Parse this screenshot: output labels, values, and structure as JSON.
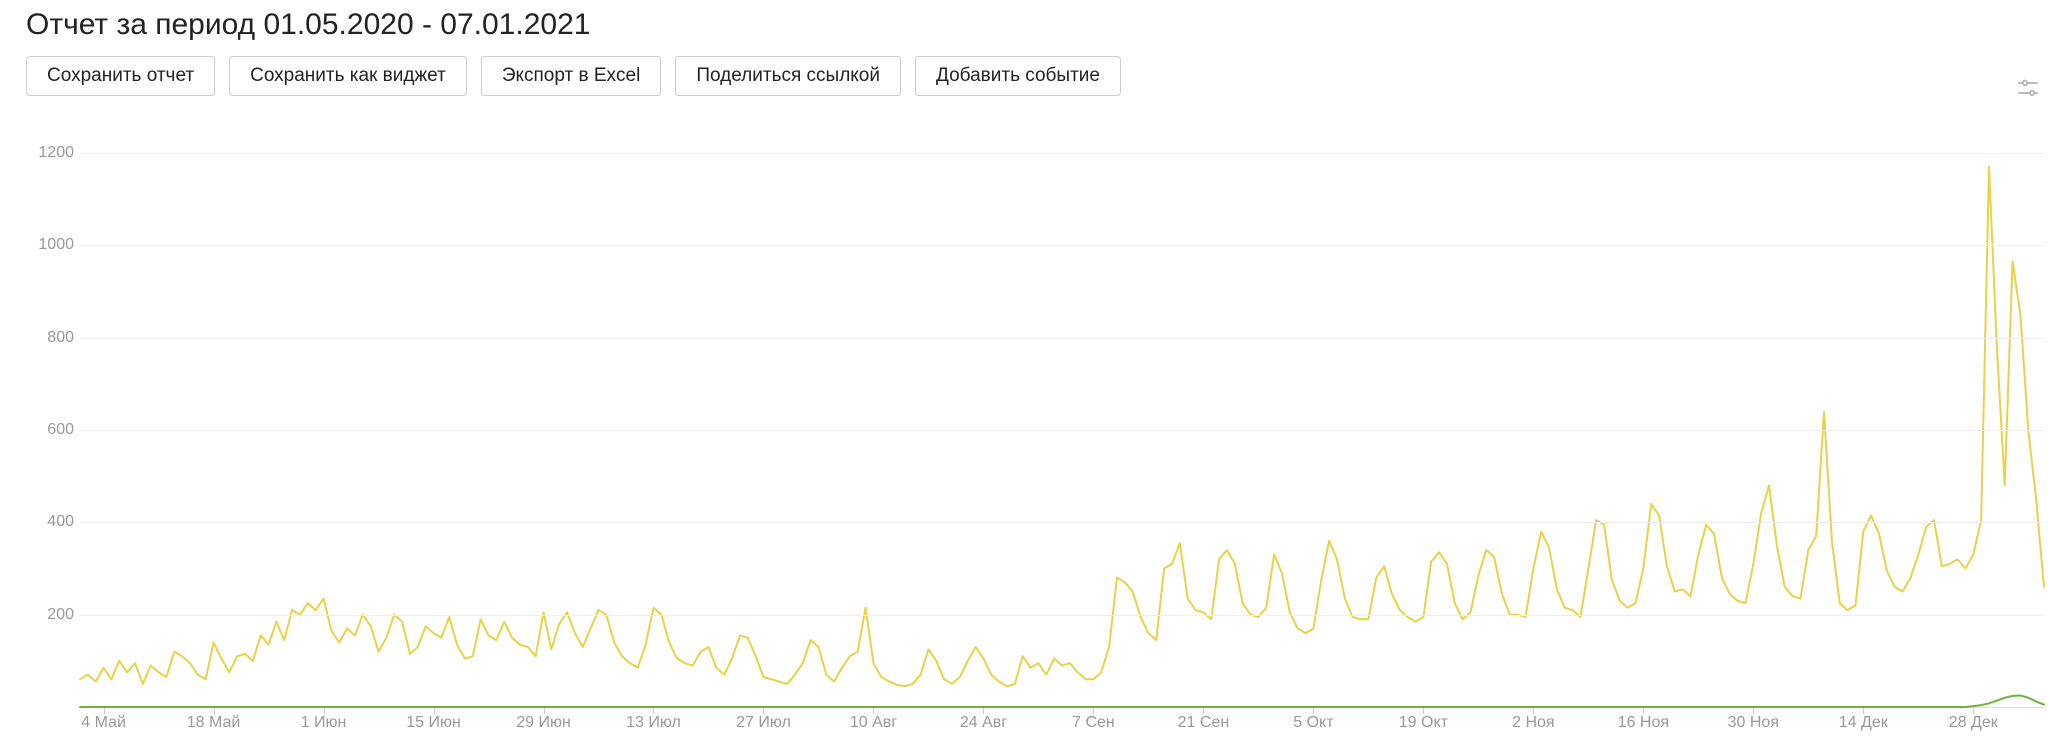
{
  "header": {
    "title": "Отчет за период 01.05.2020 - 07.01.2021"
  },
  "toolbar": {
    "save_report": "Сохранить отчет",
    "save_widget": "Сохранить как виджет",
    "export_excel": "Экспорт в Excel",
    "share_link": "Поделиться ссылкой",
    "add_event": "Добавить событие"
  },
  "chart_data": {
    "type": "line",
    "ylim": [
      0,
      1250
    ],
    "y_ticks": [
      200,
      400,
      600,
      800,
      1000,
      1200
    ],
    "x_tick_labels": [
      "4 Май",
      "18 Май",
      "1 Июн",
      "15 Июн",
      "29 Июн",
      "13 Июл",
      "27 Июл",
      "10 Авг",
      "24 Авг",
      "7 Сен",
      "21 Сен",
      "5 Окт",
      "19 Окт",
      "2 Ноя",
      "16 Ноя",
      "30 Ноя",
      "14 Дек",
      "28 Дек"
    ],
    "x_tick_indices": [
      3,
      17,
      31,
      45,
      59,
      73,
      87,
      101,
      115,
      129,
      143,
      157,
      171,
      185,
      199,
      213,
      227,
      241
    ],
    "colors": {
      "yellow": "#e8d24a",
      "green": "#6fb23c"
    },
    "series": [
      {
        "name": "yellow",
        "values": [
          60,
          70,
          55,
          85,
          60,
          100,
          75,
          95,
          50,
          90,
          75,
          65,
          120,
          110,
          95,
          70,
          60,
          140,
          105,
          75,
          110,
          115,
          100,
          155,
          135,
          185,
          145,
          210,
          200,
          225,
          210,
          235,
          165,
          140,
          170,
          155,
          200,
          175,
          120,
          150,
          200,
          185,
          115,
          130,
          175,
          160,
          150,
          195,
          135,
          105,
          110,
          190,
          155,
          145,
          185,
          150,
          135,
          130,
          110,
          205,
          125,
          180,
          205,
          160,
          130,
          170,
          210,
          200,
          140,
          110,
          95,
          85,
          135,
          215,
          200,
          140,
          105,
          95,
          90,
          120,
          130,
          85,
          70,
          105,
          155,
          150,
          110,
          65,
          60,
          55,
          50,
          70,
          95,
          145,
          130,
          70,
          55,
          85,
          110,
          120,
          215,
          95,
          65,
          55,
          48,
          45,
          50,
          70,
          125,
          100,
          60,
          50,
          65,
          100,
          130,
          105,
          70,
          55,
          45,
          50,
          110,
          85,
          95,
          70,
          105,
          90,
          95,
          75,
          60,
          60,
          75,
          130,
          280,
          270,
          250,
          195,
          160,
          145,
          300,
          310,
          355,
          235,
          210,
          205,
          190,
          320,
          340,
          310,
          225,
          200,
          195,
          215,
          330,
          290,
          205,
          170,
          160,
          170,
          275,
          360,
          320,
          235,
          195,
          190,
          190,
          280,
          305,
          245,
          210,
          195,
          185,
          195,
          315,
          335,
          310,
          225,
          190,
          205,
          285,
          340,
          325,
          245,
          200,
          200,
          195,
          300,
          380,
          345,
          255,
          215,
          210,
          195,
          300,
          405,
          395,
          275,
          230,
          215,
          225,
          300,
          440,
          415,
          305,
          250,
          255,
          240,
          330,
          395,
          375,
          280,
          245,
          230,
          225,
          310,
          420,
          480,
          350,
          260,
          240,
          235,
          340,
          370,
          640,
          360,
          225,
          210,
          220,
          380,
          415,
          375,
          295,
          260,
          250,
          280,
          330,
          390,
          405,
          305,
          310,
          320,
          300,
          330,
          405,
          1170,
          780,
          480,
          965,
          850,
          600,
          450,
          260
        ]
      },
      {
        "name": "green",
        "values": [
          0,
          0,
          0,
          0,
          0,
          0,
          0,
          0,
          0,
          0,
          0,
          0,
          0,
          0,
          0,
          0,
          0,
          0,
          0,
          0,
          0,
          0,
          0,
          0,
          0,
          0,
          0,
          0,
          0,
          0,
          0,
          0,
          0,
          0,
          0,
          0,
          0,
          0,
          0,
          0,
          0,
          0,
          0,
          0,
          0,
          0,
          0,
          0,
          0,
          0,
          0,
          0,
          0,
          0,
          0,
          0,
          0,
          0,
          0,
          0,
          0,
          0,
          0,
          0,
          0,
          0,
          0,
          0,
          0,
          0,
          0,
          0,
          0,
          0,
          0,
          0,
          0,
          0,
          0,
          0,
          0,
          0,
          0,
          0,
          0,
          0,
          0,
          0,
          0,
          0,
          0,
          0,
          0,
          0,
          0,
          0,
          0,
          0,
          0,
          0,
          0,
          0,
          0,
          0,
          0,
          0,
          0,
          0,
          0,
          0,
          0,
          0,
          0,
          0,
          0,
          0,
          0,
          0,
          0,
          0,
          0,
          0,
          0,
          0,
          0,
          0,
          0,
          0,
          0,
          0,
          0,
          0,
          0,
          0,
          0,
          0,
          0,
          0,
          0,
          0,
          0,
          0,
          0,
          0,
          0,
          0,
          0,
          0,
          0,
          0,
          0,
          0,
          0,
          0,
          0,
          0,
          0,
          0,
          0,
          0,
          0,
          0,
          0,
          0,
          0,
          0,
          0,
          0,
          0,
          0,
          0,
          0,
          0,
          0,
          0,
          0,
          0,
          0,
          0,
          0,
          0,
          0,
          0,
          0,
          0,
          0,
          0,
          0,
          0,
          0,
          0,
          0,
          0,
          0,
          0,
          0,
          0,
          0,
          0,
          0,
          0,
          0,
          0,
          0,
          0,
          0,
          0,
          0,
          0,
          0,
          0,
          0,
          0,
          0,
          0,
          0,
          0,
          0,
          0,
          0,
          0,
          0,
          0,
          0,
          0,
          0,
          0,
          0,
          0,
          0,
          0,
          0,
          0,
          0,
          0,
          0,
          0,
          0,
          0,
          0,
          0,
          2,
          4,
          8,
          14,
          20,
          24,
          25,
          20,
          12,
          5
        ]
      }
    ]
  }
}
